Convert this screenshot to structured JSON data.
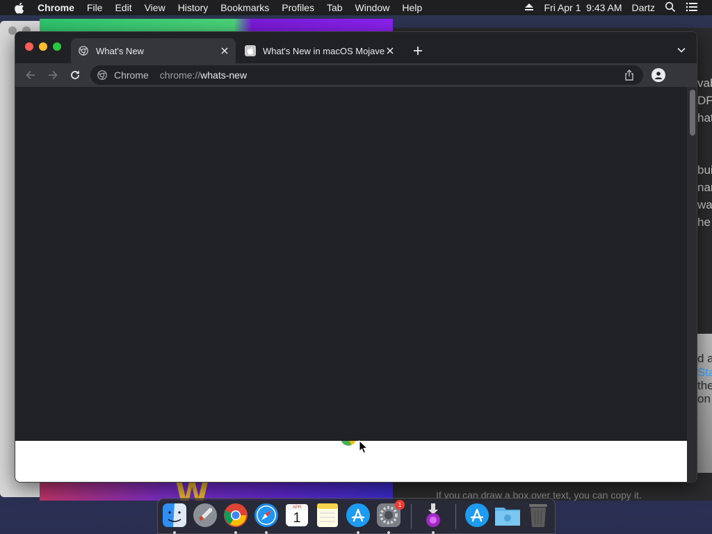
{
  "menubar": {
    "app_name": "Chrome",
    "items": [
      "File",
      "Edit",
      "View",
      "History",
      "Bookmarks",
      "Profiles",
      "Tab",
      "Window",
      "Help"
    ],
    "datetime": "Fri Apr 1  9:43 AM",
    "user": "Dartz",
    "icons": [
      "apple-icon",
      "eject-icon",
      "spotlight-icon",
      "control-center-icon"
    ]
  },
  "chrome": {
    "tabs": [
      {
        "title": "What's New",
        "favicon": "chrome-icon",
        "active": true
      },
      {
        "title": "What's New in macOS Mojave",
        "favicon": "apple-icon",
        "active": false
      }
    ],
    "omnibox": {
      "chip_label": "Chrome",
      "url_scheme": "chrome://",
      "url_path": "whats-new"
    }
  },
  "background_window": {
    "right_fragments": [
      "vab",
      "DFs",
      "hat",
      "buil",
      "nar",
      "wa",
      "he",
      "d al",
      "Sta",
      "the",
      "on"
    ],
    "bottom_text": "If you can draw a box over text, you can copy it."
  },
  "dock": {
    "items": [
      {
        "name": "finder",
        "running": true
      },
      {
        "name": "launchpad",
        "running": false
      },
      {
        "name": "chrome",
        "running": true
      },
      {
        "name": "safari",
        "running": true
      },
      {
        "name": "calendar",
        "running": false,
        "month": "APR",
        "day": "1"
      },
      {
        "name": "notes",
        "running": false
      },
      {
        "name": "app-store",
        "running": true
      },
      {
        "name": "system-preferences",
        "running": true,
        "badge": "1"
      },
      {
        "name": "downloader",
        "running": true
      },
      {
        "name": "app-store-folder",
        "running": false
      },
      {
        "name": "downloads-folder",
        "running": false
      },
      {
        "name": "trash",
        "running": false
      }
    ]
  },
  "colors": {
    "chrome_dark": "#202124",
    "chrome_toolbar": "#35363a",
    "traffic_close": "#fe5f57",
    "traffic_minimize": "#febc2e",
    "traffic_maximize": "#28c840"
  }
}
